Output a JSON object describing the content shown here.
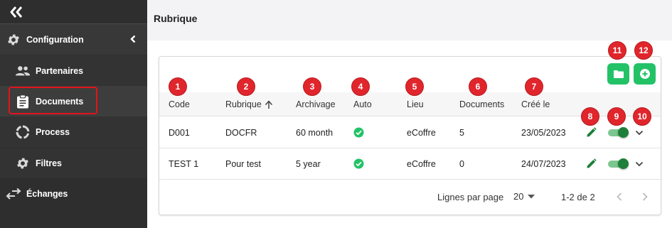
{
  "sidebar": {
    "items": [
      {
        "label": "Configuration"
      },
      {
        "label": "Partenaires"
      },
      {
        "label": "Documents"
      },
      {
        "label": "Process"
      },
      {
        "label": "Filtres"
      },
      {
        "label": "Échanges"
      }
    ]
  },
  "header": {
    "title": "Rubrique"
  },
  "table": {
    "columns": [
      "Code",
      "Rubrique",
      "Archivage",
      "Auto",
      "Lieu",
      "Documents",
      "Créé le"
    ],
    "sort_column": "Rubrique",
    "sort_direction": "ascending",
    "rows": [
      {
        "code": "D001",
        "rubrique": "DOCFR",
        "archivage": "60 month",
        "auto": true,
        "lieu": "eCoffre",
        "documents": "5",
        "cree_le": "23/05/2023",
        "toggle": "on"
      },
      {
        "code": "TEST 1",
        "rubrique": "Pour test",
        "archivage": "5 year",
        "auto": true,
        "lieu": "eCoffre",
        "documents": "0",
        "cree_le": "24/07/2023",
        "toggle": "on"
      }
    ]
  },
  "pagination": {
    "rows_per_page_label": "Lignes par page",
    "rows_per_page_value": "20",
    "range_text": "1-2 de 2"
  },
  "badges": [
    "1",
    "2",
    "3",
    "4",
    "5",
    "6",
    "7",
    "8",
    "9",
    "10",
    "11",
    "12"
  ],
  "colors": {
    "sidebar_bg": "#2e2e2e",
    "accent_green": "#23c267",
    "toggle_on": "#1e7f3a",
    "badge_red": "#e0262c",
    "highlight_red": "#e3131b"
  },
  "icons": {
    "collapse": "double-chevron-left-icon",
    "configuration": "gear-icon",
    "partenaires": "people-icon",
    "documents": "clipboard-icon",
    "process": "cycle-icon",
    "filtres": "gear-icon",
    "echanges": "swap-arrows-icon",
    "edit": "pencil-icon",
    "expand": "chevron-down-icon",
    "folder": "folder-icon",
    "add": "plus-circle-icon",
    "auto": "check-circle-icon"
  }
}
